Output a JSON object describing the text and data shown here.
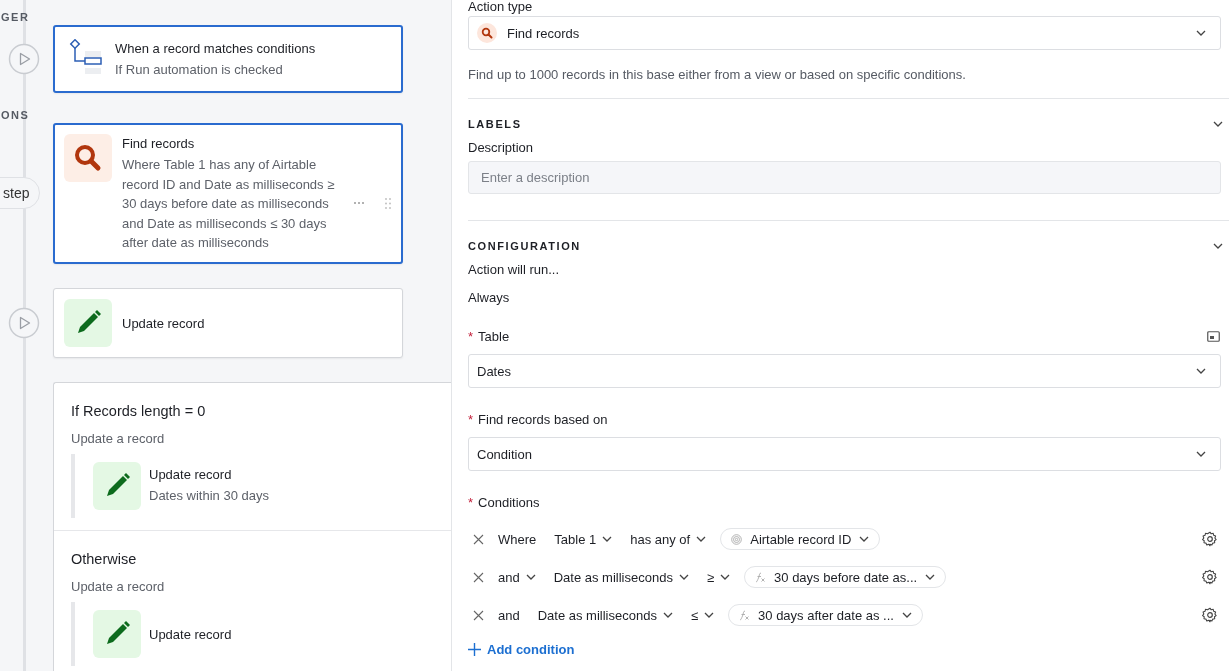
{
  "flow": {
    "trigger_label": "GER",
    "trigger": {
      "title": "When a record matches conditions",
      "subtitle": "If Run automation is checked",
      "selected": true
    },
    "actions_label": "ONS",
    "add_step": "step",
    "steps": [
      {
        "kind": "find",
        "title": "Find records",
        "subtitle": "Where Table 1 has any of Airtable record ID and Date as milliseconds ≥ 30 days before date as milliseconds and Date as milliseconds ≤ 30 days after date as milliseconds",
        "selected": true
      },
      {
        "kind": "update",
        "title": "Update record",
        "selected": false
      }
    ],
    "branches": [
      {
        "title": "If Records length = 0",
        "subtitle": "Update a record",
        "step": {
          "kind": "update",
          "title": "Update record",
          "subtitle": "Dates within 30 days"
        }
      },
      {
        "title": "Otherwise",
        "subtitle": "Update a record",
        "step": {
          "kind": "update",
          "title": "Update record"
        }
      }
    ]
  },
  "editor": {
    "action_type": {
      "label": "Action type",
      "value": "Find records"
    },
    "help": "Find up to 1000 records in this base either from a view or based on specific conditions.",
    "labels": {
      "heading": "LABELS",
      "description_label": "Description",
      "description_placeholder": "Enter a description"
    },
    "configuration": {
      "heading": "CONFIGURATION",
      "run_label": "Action will run...",
      "run_value": "Always",
      "table": {
        "label": "Table",
        "required_mark": "*",
        "value": "Dates"
      },
      "based_on": {
        "label": "Find records based on",
        "required_mark": "*",
        "value": "Condition"
      },
      "conditions_label": "Conditions",
      "conditions_required_mark": "*",
      "conditions": [
        {
          "conjunction": "Where",
          "conjunction_dropdown": false,
          "field": "Table 1",
          "operator": "has any of",
          "value": "Airtable record ID",
          "kind": "field"
        },
        {
          "conjunction": "and",
          "conjunction_dropdown": true,
          "field": "Date as milliseconds",
          "operator": "≥",
          "value": "30 days before date as...",
          "kind": "formula"
        },
        {
          "conjunction": "and",
          "conjunction_dropdown": false,
          "field": "Date as milliseconds",
          "operator": "≤",
          "value": "30 days after date as ...",
          "kind": "formula"
        }
      ],
      "add_condition": "Add condition"
    }
  }
}
